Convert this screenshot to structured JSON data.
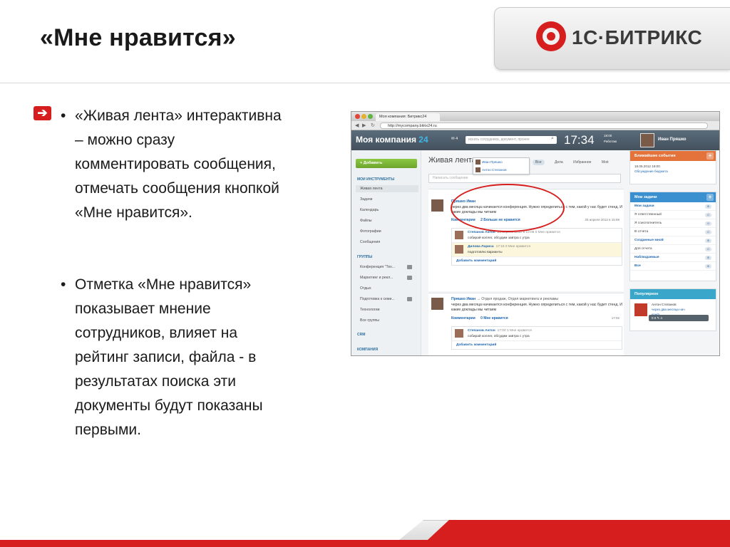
{
  "slide": {
    "title": "«Мне нравится»",
    "logo_text": "1С·БИТРИКС",
    "bullets": [
      {
        "lines": [
          "«Живая лента» интерактивна",
          "– можно сразу",
          "комментировать сообщения,",
          "отмечать сообщения кнопкой",
          "«Мне нравится»."
        ]
      },
      {
        "lines": [
          "Отметка «Мне нравится»",
          "показывает мнение",
          "сотрудников, влияет на",
          "рейтинг записи, файла - в",
          "результатах поиска эти",
          "документы будут показаны",
          "первыми."
        ]
      }
    ],
    "bullet_mark": "•",
    "arrow_glyph": "➔"
  },
  "browser": {
    "tab_title": "Моя компания: Битрикс24",
    "url": "http://mycompany.bitrix24.ru"
  },
  "portal": {
    "company": "Моя компания",
    "company_num": "24",
    "inbox_count": "4",
    "search_placeholder": "искать сотрудника, документ, прочее",
    "time": "17:34",
    "time_meta_1": "18:00",
    "time_meta_2": "Работаю",
    "user_name": "Иван Пряшко",
    "add_button": "+ Добавить",
    "nav": {
      "my_tools": "МОИ ИНСТРУМЕНТЫ",
      "items": [
        "Живая лента",
        "Задачи",
        "Календарь",
        "Файлы",
        "Фотографии",
        "Сообщения"
      ],
      "groups": "ГРУППЫ",
      "group_items": [
        "Конференция \"Тех...",
        "Маркетинг и рекл...",
        "Отдых",
        "Подготовка к семи...",
        "Технологии",
        "Все группы"
      ],
      "crm": "CRM",
      "company": "КОМПАНИЯ"
    },
    "feed": {
      "title": "Живая лента",
      "tabs": [
        "Все",
        "Дела",
        "Избранное",
        "Моё"
      ],
      "post_placeholder": "Написать сообщение",
      "posts": [
        {
          "author": "Пряшко Иван",
          "text": "через два месяца начинается конференция. Нужно определиться с тем, какой у нас будет стенд. И какие доклады мы читаем",
          "comments_label": "Комментарии",
          "likes_label": "2 Больше не нравится",
          "date": "25 апреля 2012 в 15:59",
          "comments": [
            {
              "author": "Степанов Антон",
              "meta": "25 апреля 2012 в 10:08  0 Мне нравится",
              "text": "собирай коллег, обсудим завтра с утра"
            },
            {
              "author": "Дилова Лариса",
              "meta": "17:15  0 Мне нравится",
              "text": "подготовлю варианты"
            }
          ],
          "add_comment": "Добавить комментарий"
        },
        {
          "author": "Пряшко Иван",
          "target": "→ Отдел продаж, Отдел маркетинга и рекламы",
          "text": "через два месяца начинается конференция. Нужно определиться с тем, какой у нас будет стенд. И какие доклады мы читаем",
          "comments_label": "Комментарии",
          "likes_label": "0 Мне нравится",
          "date": "17:02",
          "comments": [
            {
              "author": "Степанов Антон",
              "meta": "17:00  1 Мне нравится",
              "text": "собирай коллег, обсудим завтра с утра"
            }
          ],
          "add_comment": "Добавить комментарий"
        }
      ],
      "likes_popup": [
        "Иван Пряшко",
        "Антон Степанов"
      ]
    },
    "right": {
      "events_title": "Ближайшие события",
      "event_date": "18.05.2012 18:00",
      "event_link": "Обсуждение бюджета",
      "tasks_title": "Мои задачи",
      "tasks": [
        {
          "label": "Мои задачи",
          "count": "0",
          "bold": true
        },
        {
          "label": "Я ответственный",
          "count": "0",
          "bold": false
        },
        {
          "label": "Я соисполнитель",
          "count": "0",
          "bold": false
        },
        {
          "label": "В отчета",
          "count": "0",
          "bold": false
        },
        {
          "label": "Созданные мной",
          "count": "0",
          "bold": true
        },
        {
          "label": "Для отчета",
          "count": "0",
          "bold": false
        },
        {
          "label": "Наблюдаемые",
          "count": "0",
          "bold": true
        },
        {
          "label": "Все",
          "count": "0",
          "bold": true
        }
      ],
      "popular_title": "Популярное",
      "popular_author": "Антон Степанов",
      "popular_text_1": "через два месяца нач",
      "popular_text_2": "конф",
      "popular_bar": "0   0   ✎ 4"
    },
    "colors": {
      "header": "#4e5c69",
      "accent": "#3fb6e9",
      "green": "#7ab536",
      "orange": "#e4723b",
      "blue": "#3a8fd0",
      "teal": "#3aa6c9"
    }
  }
}
